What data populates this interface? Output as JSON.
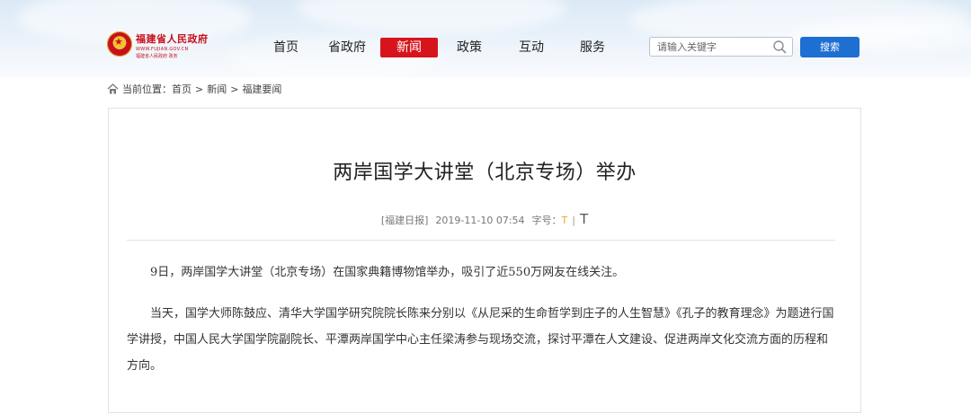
{
  "site": {
    "logo_title": "福建省人民政府",
    "logo_url": "WWW.FUJIAN.GOV.CN",
    "logo_sub": "福建省人民政府 政务"
  },
  "nav": {
    "items": [
      {
        "label": "首页",
        "active": false
      },
      {
        "label": "省政府",
        "active": false
      },
      {
        "label": "新闻",
        "active": true
      },
      {
        "label": "政策",
        "active": false
      },
      {
        "label": "互动",
        "active": false
      },
      {
        "label": "服务",
        "active": false
      }
    ]
  },
  "search": {
    "placeholder": "请输入关键字",
    "button_label": "搜索"
  },
  "breadcrumb": {
    "prefix": "当前位置：",
    "items": [
      "首页",
      "新闻",
      "福建要闻"
    ],
    "separator": ">"
  },
  "article": {
    "title": "两岸国学大讲堂（北京专场）举办",
    "source": "[福建日报]",
    "datetime": "2019-11-10 07:54",
    "font_size_label": "字号：",
    "font_small": "T",
    "font_divider": "|",
    "font_large": "T",
    "paragraphs": [
      "9日，两岸国学大讲堂（北京专场）在国家典籍博物馆举办，吸引了近550万网友在线关注。",
      "当天，国学大师陈鼓应、清华大学国学研究院院长陈来分别以《从尼采的生命哲学到庄子的人生智慧》《孔子的教育理念》为题进行国学讲授，中国人民大学国学院副院长、平潭两岸国学中心主任梁涛参与现场交流，探讨平潭在人文建设、促进两岸文化交流方面的历程和方向。"
    ]
  },
  "colors": {
    "accent_red": "#d7141c",
    "button_blue": "#1d6fd1",
    "font_small_color": "#e8a23a"
  }
}
